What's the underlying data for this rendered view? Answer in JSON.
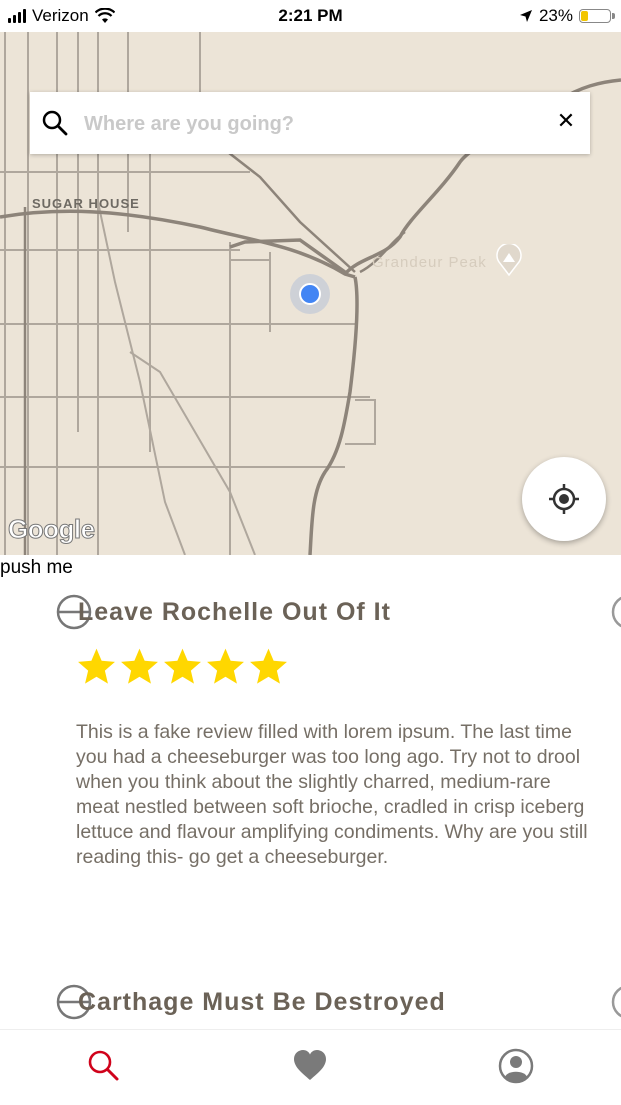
{
  "status_bar": {
    "carrier": "Verizon",
    "time": "2:21 PM",
    "battery": "23%",
    "battery_level": 0.23,
    "icons": [
      "signal-bars-icon",
      "wifi-icon",
      "location-arrow-icon",
      "battery-icon"
    ]
  },
  "map": {
    "search": {
      "placeholder": "Where are you going?",
      "value": ""
    },
    "labels": {
      "neighborhood": "SUGAR HOUSE",
      "peak": "Grandeur Peak"
    },
    "attribution": "Google",
    "colors": {
      "land": "#ece4d7",
      "road": "#8d847a",
      "user_dot": "#4285f4"
    },
    "icons": [
      "search-icon",
      "close-icon",
      "mountain-pin-icon",
      "crosshair-locate-icon"
    ]
  },
  "push_button_label": "push me",
  "reviews": [
    {
      "title": "Leave Rochelle Out Of It",
      "rating": 5,
      "text": "This is a fake review filled with lorem ipsum. The last time you had a cheeseburger was too long ago. Try not to drool when you think about the slightly charred, medium-rare meat nestled between soft brioche, cradled in crisp iceberg lettuce and flavour amplifying condiments. Why are you still reading this- go get a cheeseburger."
    },
    {
      "title": "Carthage Must Be Destroyed"
    }
  ],
  "tab_bar": {
    "tabs": [
      {
        "name": "search",
        "icon": "search-icon",
        "active": true,
        "color": "#d0021b"
      },
      {
        "name": "favorites",
        "icon": "heart-icon",
        "active": false,
        "color": "#7a7a7a"
      },
      {
        "name": "profile",
        "icon": "user-icon",
        "active": false,
        "color": "#7a7a7a"
      }
    ]
  }
}
